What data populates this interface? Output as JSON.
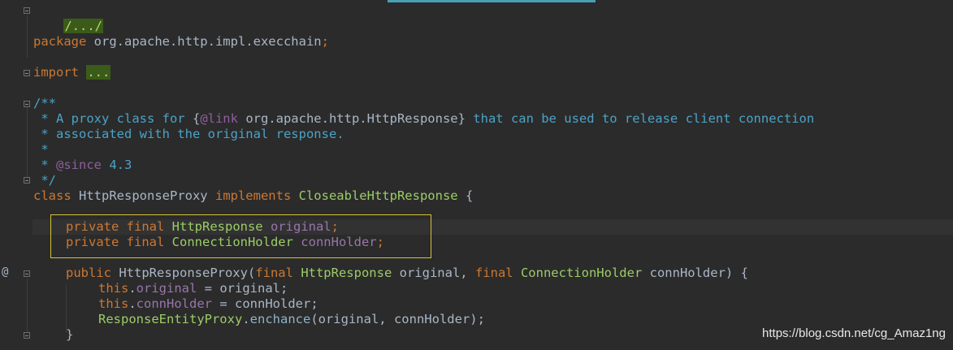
{
  "editor": {
    "lines": {
      "l1": {
        "folded": "/.../"
      },
      "l2": {
        "kw": "package",
        "pkg": " org.apache.http.impl.execchain",
        "end": ";"
      },
      "l3": {
        "kw": "import",
        "folded": "..."
      },
      "l4": {
        "text": "/**"
      },
      "l5": {
        "a": " * A proxy class for ",
        "b": "{",
        "c": "@link",
        "d": " org.apache.http.HttpResponse",
        "e": "}",
        "f": " that can be used to release client connection"
      },
      "l6": {
        "text": " * associated with the original response."
      },
      "l7": {
        "text": " *"
      },
      "l8": {
        "a": " * ",
        "b": "@since",
        "c": " 4.3"
      },
      "l9": {
        "text": " */"
      },
      "l10": {
        "kw1": "class",
        "name": " HttpResponseProxy ",
        "kw2": "implements",
        "iface": " CloseableHttpResponse",
        "end": " {"
      },
      "l11": {
        "kw": "private final",
        "type": " HttpResponse",
        "field": " original",
        "end": ";"
      },
      "l12": {
        "kw": "private final",
        "type": " ConnectionHolder",
        "field": " connHolder",
        "end": ";"
      },
      "l13": {
        "kw": "public",
        "name": " HttpResponseProxy(",
        "kw2": "final",
        "t1": " HttpResponse",
        "p1": " original, ",
        "kw3": "final",
        "t2": " ConnectionHolder",
        "p2": " connHolder) {"
      },
      "l14": {
        "kw": "this",
        "dot": ".",
        "field": "original",
        "rest": " = original;"
      },
      "l15": {
        "kw": "this",
        "dot": ".",
        "field": "connHolder",
        "rest": " = connHolder;"
      },
      "l16": {
        "cls": "ResponseEntityProxy",
        "dot": ".",
        "call": "enchance",
        "rest": "(original, connHolder);"
      },
      "l17": {
        "text": "}"
      }
    },
    "gutter_marker": "@"
  },
  "watermark": "https://blog.csdn.net/cg_Amaz1ng"
}
